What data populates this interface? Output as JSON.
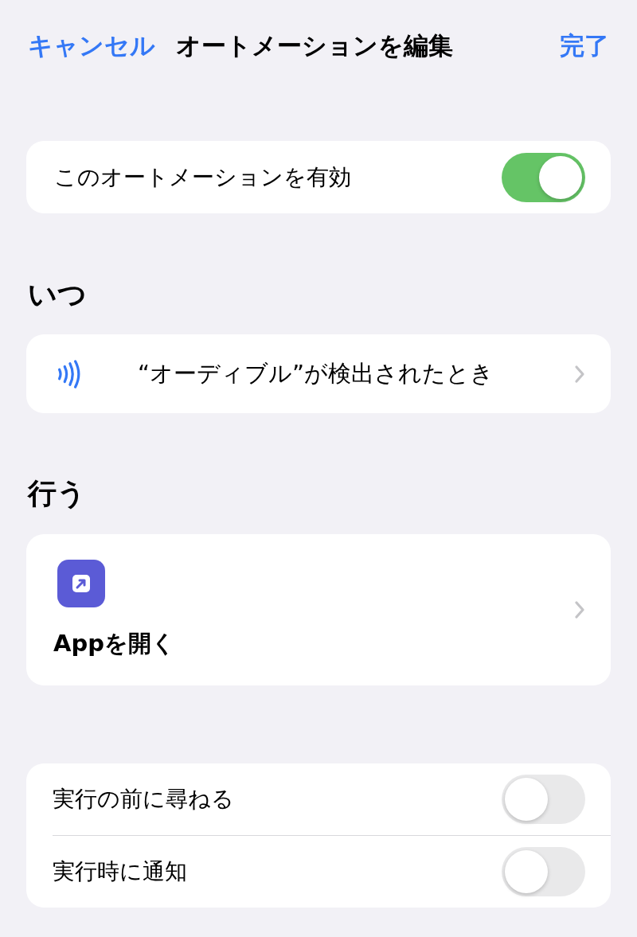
{
  "nav": {
    "cancel": "キャンセル",
    "title": "オートメーションを編集",
    "done": "完了"
  },
  "enable": {
    "label": "このオートメーションを有効",
    "on": true
  },
  "when": {
    "header": "いつ",
    "trigger": "“オーディブル”が検出されたとき"
  },
  "do": {
    "header": "行う",
    "action": "Appを開く"
  },
  "options": [
    {
      "label": "実行の前に尋ねる",
      "on": false
    },
    {
      "label": "実行時に通知",
      "on": false
    }
  ]
}
